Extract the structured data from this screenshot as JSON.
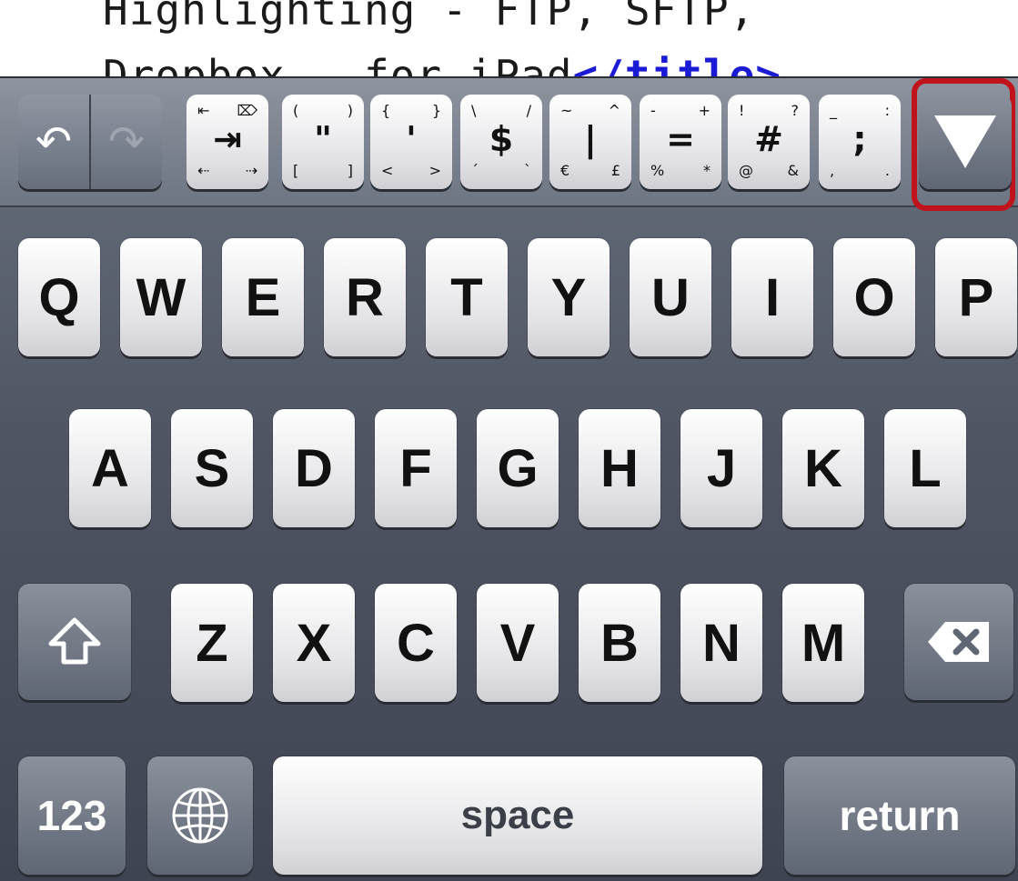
{
  "editor": {
    "line1": "Highlighting - FTP, SFTP,",
    "line2_text": "Dropbox - for iPad",
    "line2_tag": "</title>"
  },
  "toolbar": {
    "undo_icon": "undo-arrow-icon",
    "redo_icon": "redo-arrow-icon",
    "keys": [
      {
        "name": "tab-key",
        "tl": "⇤",
        "tr": "⌦",
        "c": "⇥",
        "bl": "⇠",
        "br": "⇢"
      },
      {
        "name": "paren-quote-key",
        "tl": "(",
        "tr": ")",
        "c": "\"",
        "bl": "[",
        "br": "]"
      },
      {
        "name": "brace-apostrophe-key",
        "tl": "{",
        "tr": "}",
        "c": "'",
        "bl": "<",
        "br": ">"
      },
      {
        "name": "dollar-key",
        "tl": "\\",
        "tr": "/",
        "c": "$",
        "bl": "´",
        "br": "`"
      },
      {
        "name": "pipe-key",
        "tl": "~",
        "tr": "^",
        "c": "|",
        "bl": "€",
        "br": "£"
      },
      {
        "name": "equals-key",
        "tl": "-",
        "tr": "+",
        "c": "=",
        "bl": "%",
        "br": "*"
      },
      {
        "name": "hash-key",
        "tl": "!",
        "tr": "?",
        "c": "#",
        "bl": "@",
        "br": "&"
      },
      {
        "name": "semicolon-key",
        "tl": "_",
        "tr": ":",
        "c": ";",
        "bl": ",",
        "br": "."
      }
    ],
    "dismiss_icon": "dismiss-keyboard-triangle-icon"
  },
  "rows": {
    "row1": [
      "Q",
      "W",
      "E",
      "R",
      "T",
      "Y",
      "U",
      "I",
      "O",
      "P"
    ],
    "row2": [
      "A",
      "S",
      "D",
      "F",
      "G",
      "H",
      "J",
      "K",
      "L"
    ],
    "row3": [
      "Z",
      "X",
      "C",
      "V",
      "B",
      "N",
      "M"
    ]
  },
  "bottom": {
    "numbers_label": "123",
    "space_label": "space",
    "return_label": "return"
  },
  "colors": {
    "highlight": "#c0131b",
    "tag": "#1b1bd6"
  }
}
